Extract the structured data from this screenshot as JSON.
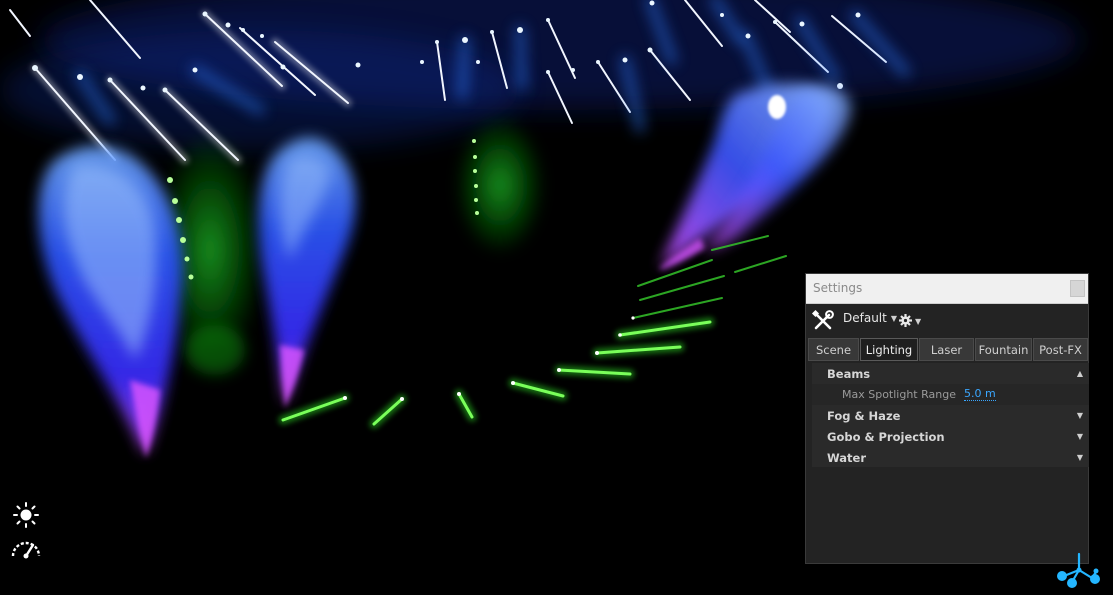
{
  "viewport": {
    "sun_icon": "sun-icon",
    "gauge_icon": "speedometer-icon",
    "logo_icon": "molecule-logo-icon"
  },
  "settings": {
    "title": "Settings",
    "preset": "Default",
    "tabs": [
      {
        "label": "Scene"
      },
      {
        "label": "Lighting",
        "active": true
      },
      {
        "label": "Laser"
      },
      {
        "label": "Fountain"
      },
      {
        "label": "Post-FX"
      }
    ],
    "sections": {
      "beams": {
        "label": "Beams",
        "expanded": true
      },
      "fog": {
        "label": "Fog & Haze"
      },
      "gobo": {
        "label": "Gobo & Projection"
      },
      "water": {
        "label": "Water"
      }
    },
    "max_spotlight_range": {
      "label": "Max Spotlight Range",
      "value": "5.0 m"
    }
  },
  "colors": {
    "accent_blue": "#3aa7ff",
    "fog_blue": "#2f5dff",
    "fog_magenta": "#c23cff",
    "beam_green": "#4dff3a",
    "beam_white": "#e8eeff"
  }
}
